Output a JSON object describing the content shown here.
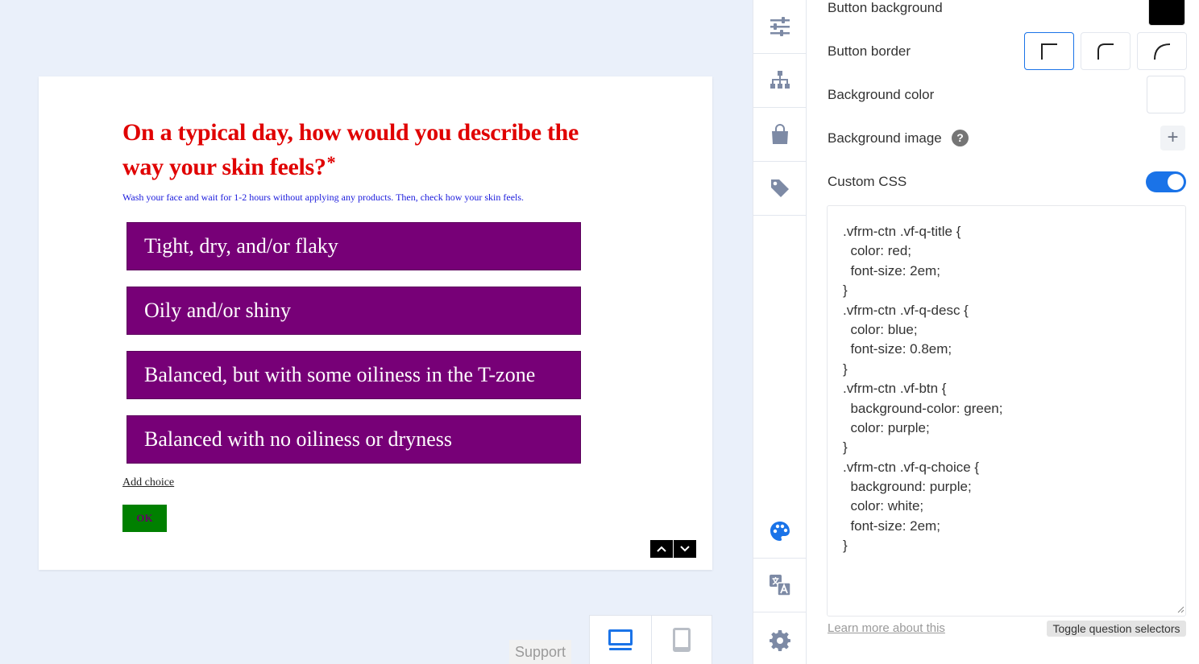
{
  "preview": {
    "question_title": "On a typical day, how would you describe the way your skin feels?",
    "required_mark": "*",
    "description": "Wash your face and wait for 1-2 hours without applying any products. Then, check how your skin feels.",
    "choices": [
      "Tight, dry, and/or flaky",
      "Oily and/or shiny",
      "Balanced, but with some oiliness in the T-zone",
      "Balanced with no oiliness or dryness"
    ],
    "add_choice_label": "Add choice",
    "ok_label": "OK"
  },
  "bottom": {
    "support_label": "Support",
    "devices": [
      "desktop-icon",
      "tablet-icon"
    ]
  },
  "rail": {
    "items": [
      "sliders-icon",
      "sitemap-icon",
      "shopping-bag-icon",
      "tag-icon",
      "palette-icon",
      "translate-icon",
      "gear-icon"
    ],
    "active": "palette-icon"
  },
  "panel": {
    "button_background_label": "Button background",
    "button_background_color": "#000000",
    "button_border_label": "Button border",
    "background_color_label": "Background color",
    "background_color_value": "#ffffff",
    "background_image_label": "Background image",
    "help_glyph": "?",
    "plus_glyph": "+",
    "custom_css_label": "Custom CSS",
    "custom_css_enabled": true,
    "custom_css_lines": [
      ".vfrm-ctn .vf-q-title {",
      "  color: red;",
      "  font-size: 2em;",
      "}",
      ".vfrm-ctn .vf-q-desc {",
      "  color: blue;",
      "  font-size: 0.8em;",
      "}",
      ".vfrm-ctn .vf-btn {",
      "  background-color: green;",
      "  color: purple;",
      "}",
      ".vfrm-ctn .vf-q-choice {",
      "  background: purple;",
      "  color: white;",
      "  font-size: 2em;",
      "}"
    ],
    "learn_more_label": "Learn more about this",
    "toggle_selectors_label": "Toggle question selectors"
  },
  "colors": {
    "accent": "#1a73e8",
    "title": "#e00000",
    "desc": "#1a1adc",
    "choice_bg": "#770077",
    "ok_bg": "#008000",
    "rail_icon": "#7d8aa5"
  }
}
